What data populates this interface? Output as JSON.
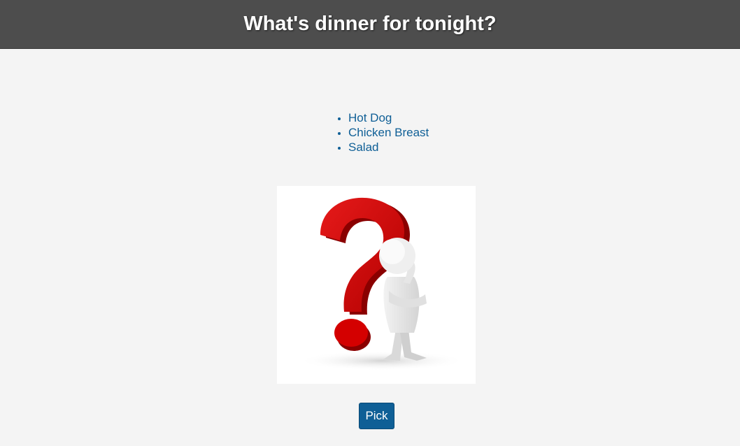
{
  "header": {
    "title": "What's dinner for tonight?"
  },
  "dinner_options": [
    "Hot Dog",
    "Chicken Breast",
    "Salad"
  ],
  "illustration": {
    "icon": "thinking-figure-question-mark-icon"
  },
  "actions": {
    "pick_label": "Pick"
  },
  "colors": {
    "header_bg": "#4d4d4d",
    "page_bg": "#f4f4f4",
    "accent": "#0f5f96",
    "question_mark": "#d40000"
  }
}
